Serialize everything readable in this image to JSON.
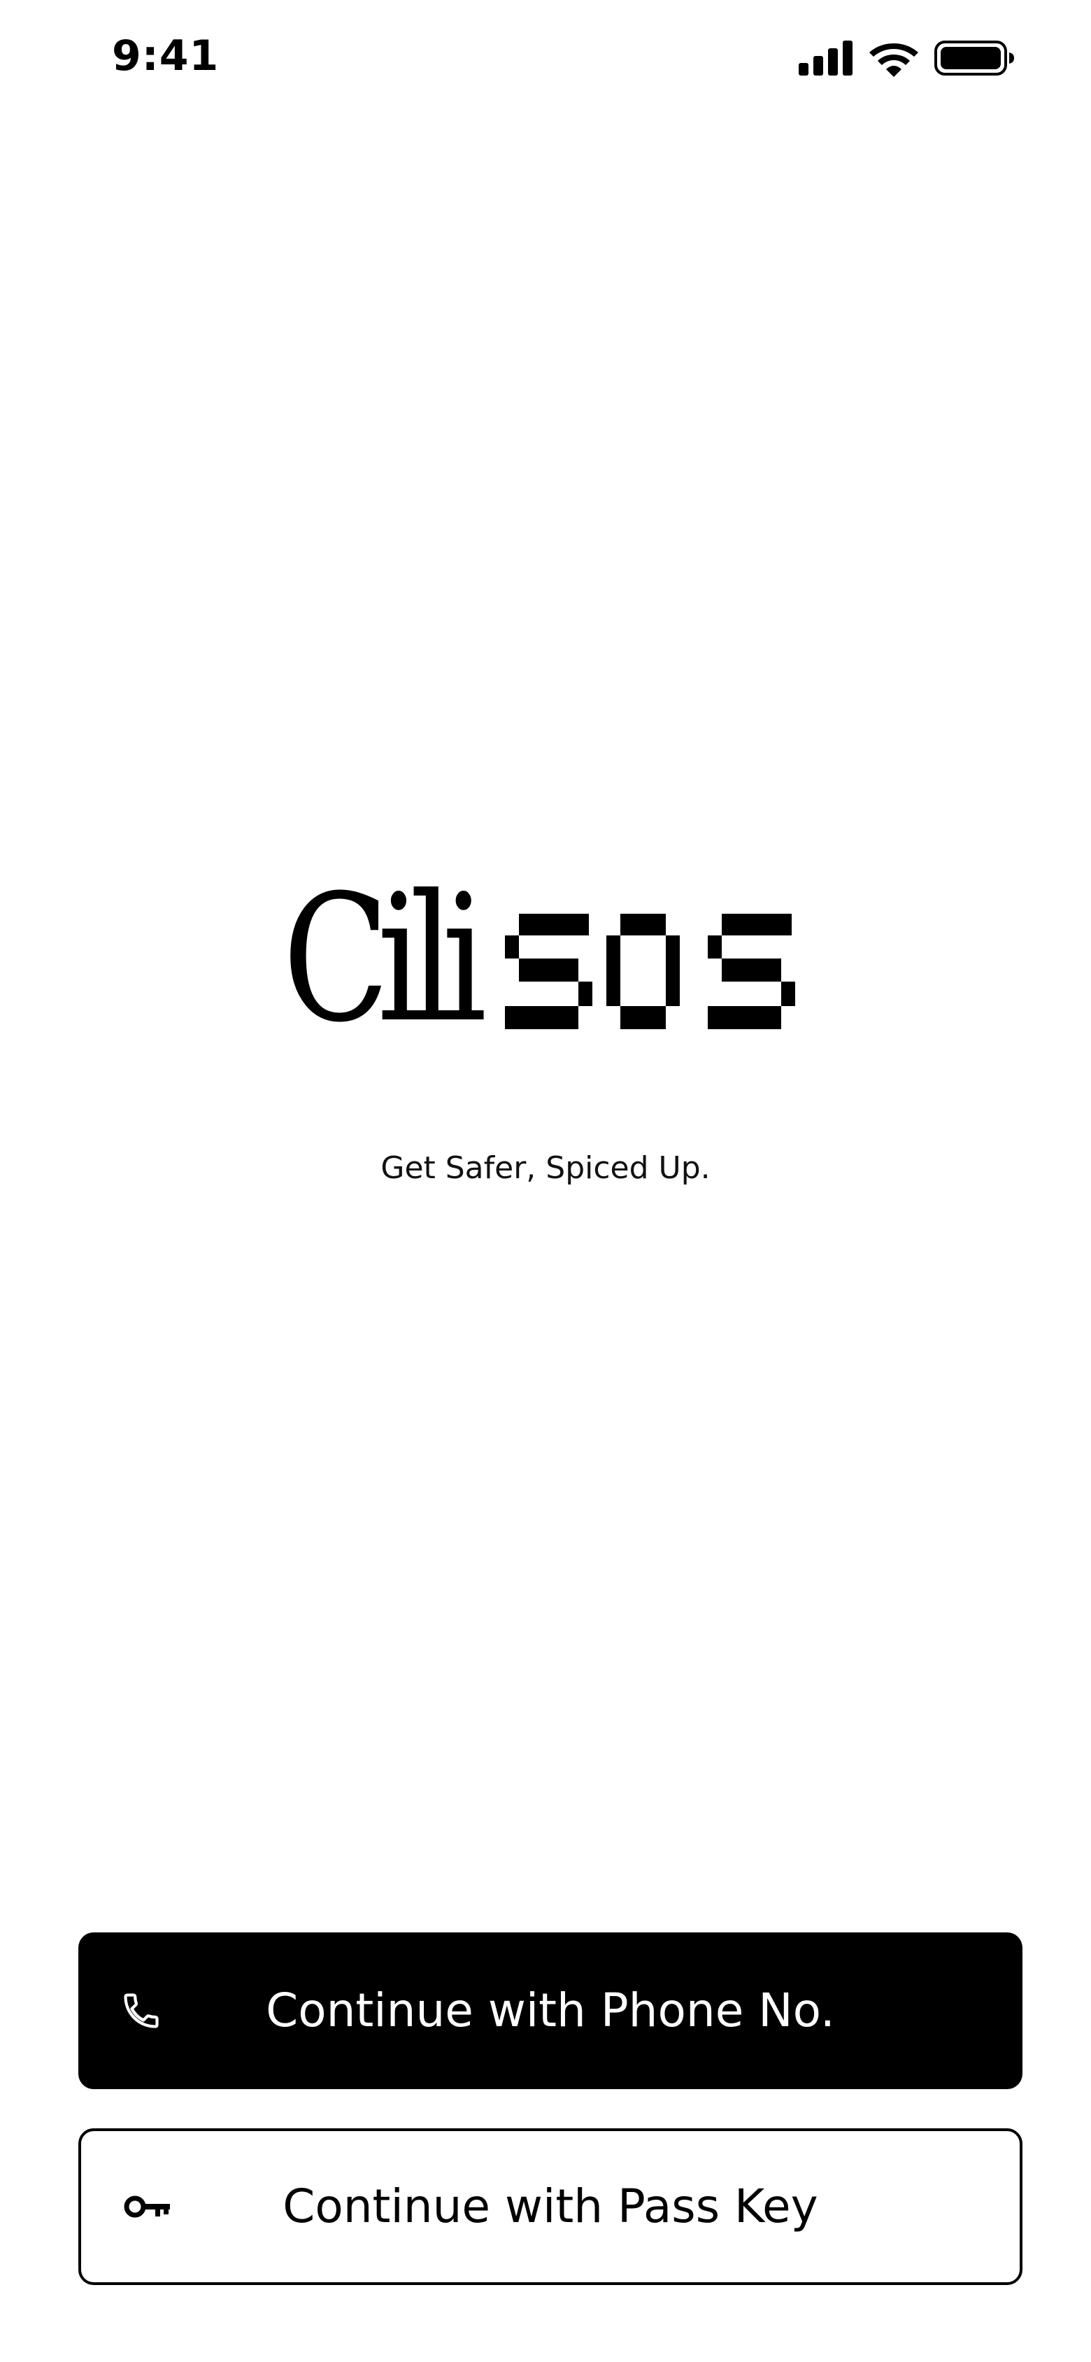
{
  "status_bar": {
    "time": "9:41",
    "icons": [
      "signal-bars-icon",
      "wifi-icon",
      "battery-icon"
    ]
  },
  "brand": {
    "wordmark": "Cili",
    "mark": "SOS",
    "tagline": "Get Safer, Spiced Up."
  },
  "actions": {
    "phone": {
      "label": "Continue with Phone No.",
      "icon": "phone-icon"
    },
    "passkey": {
      "label": "Continue with Pass Key",
      "icon": "key-icon"
    }
  },
  "colors": {
    "background": "#ffffff",
    "primary": "#000000",
    "on_primary": "#ffffff"
  }
}
